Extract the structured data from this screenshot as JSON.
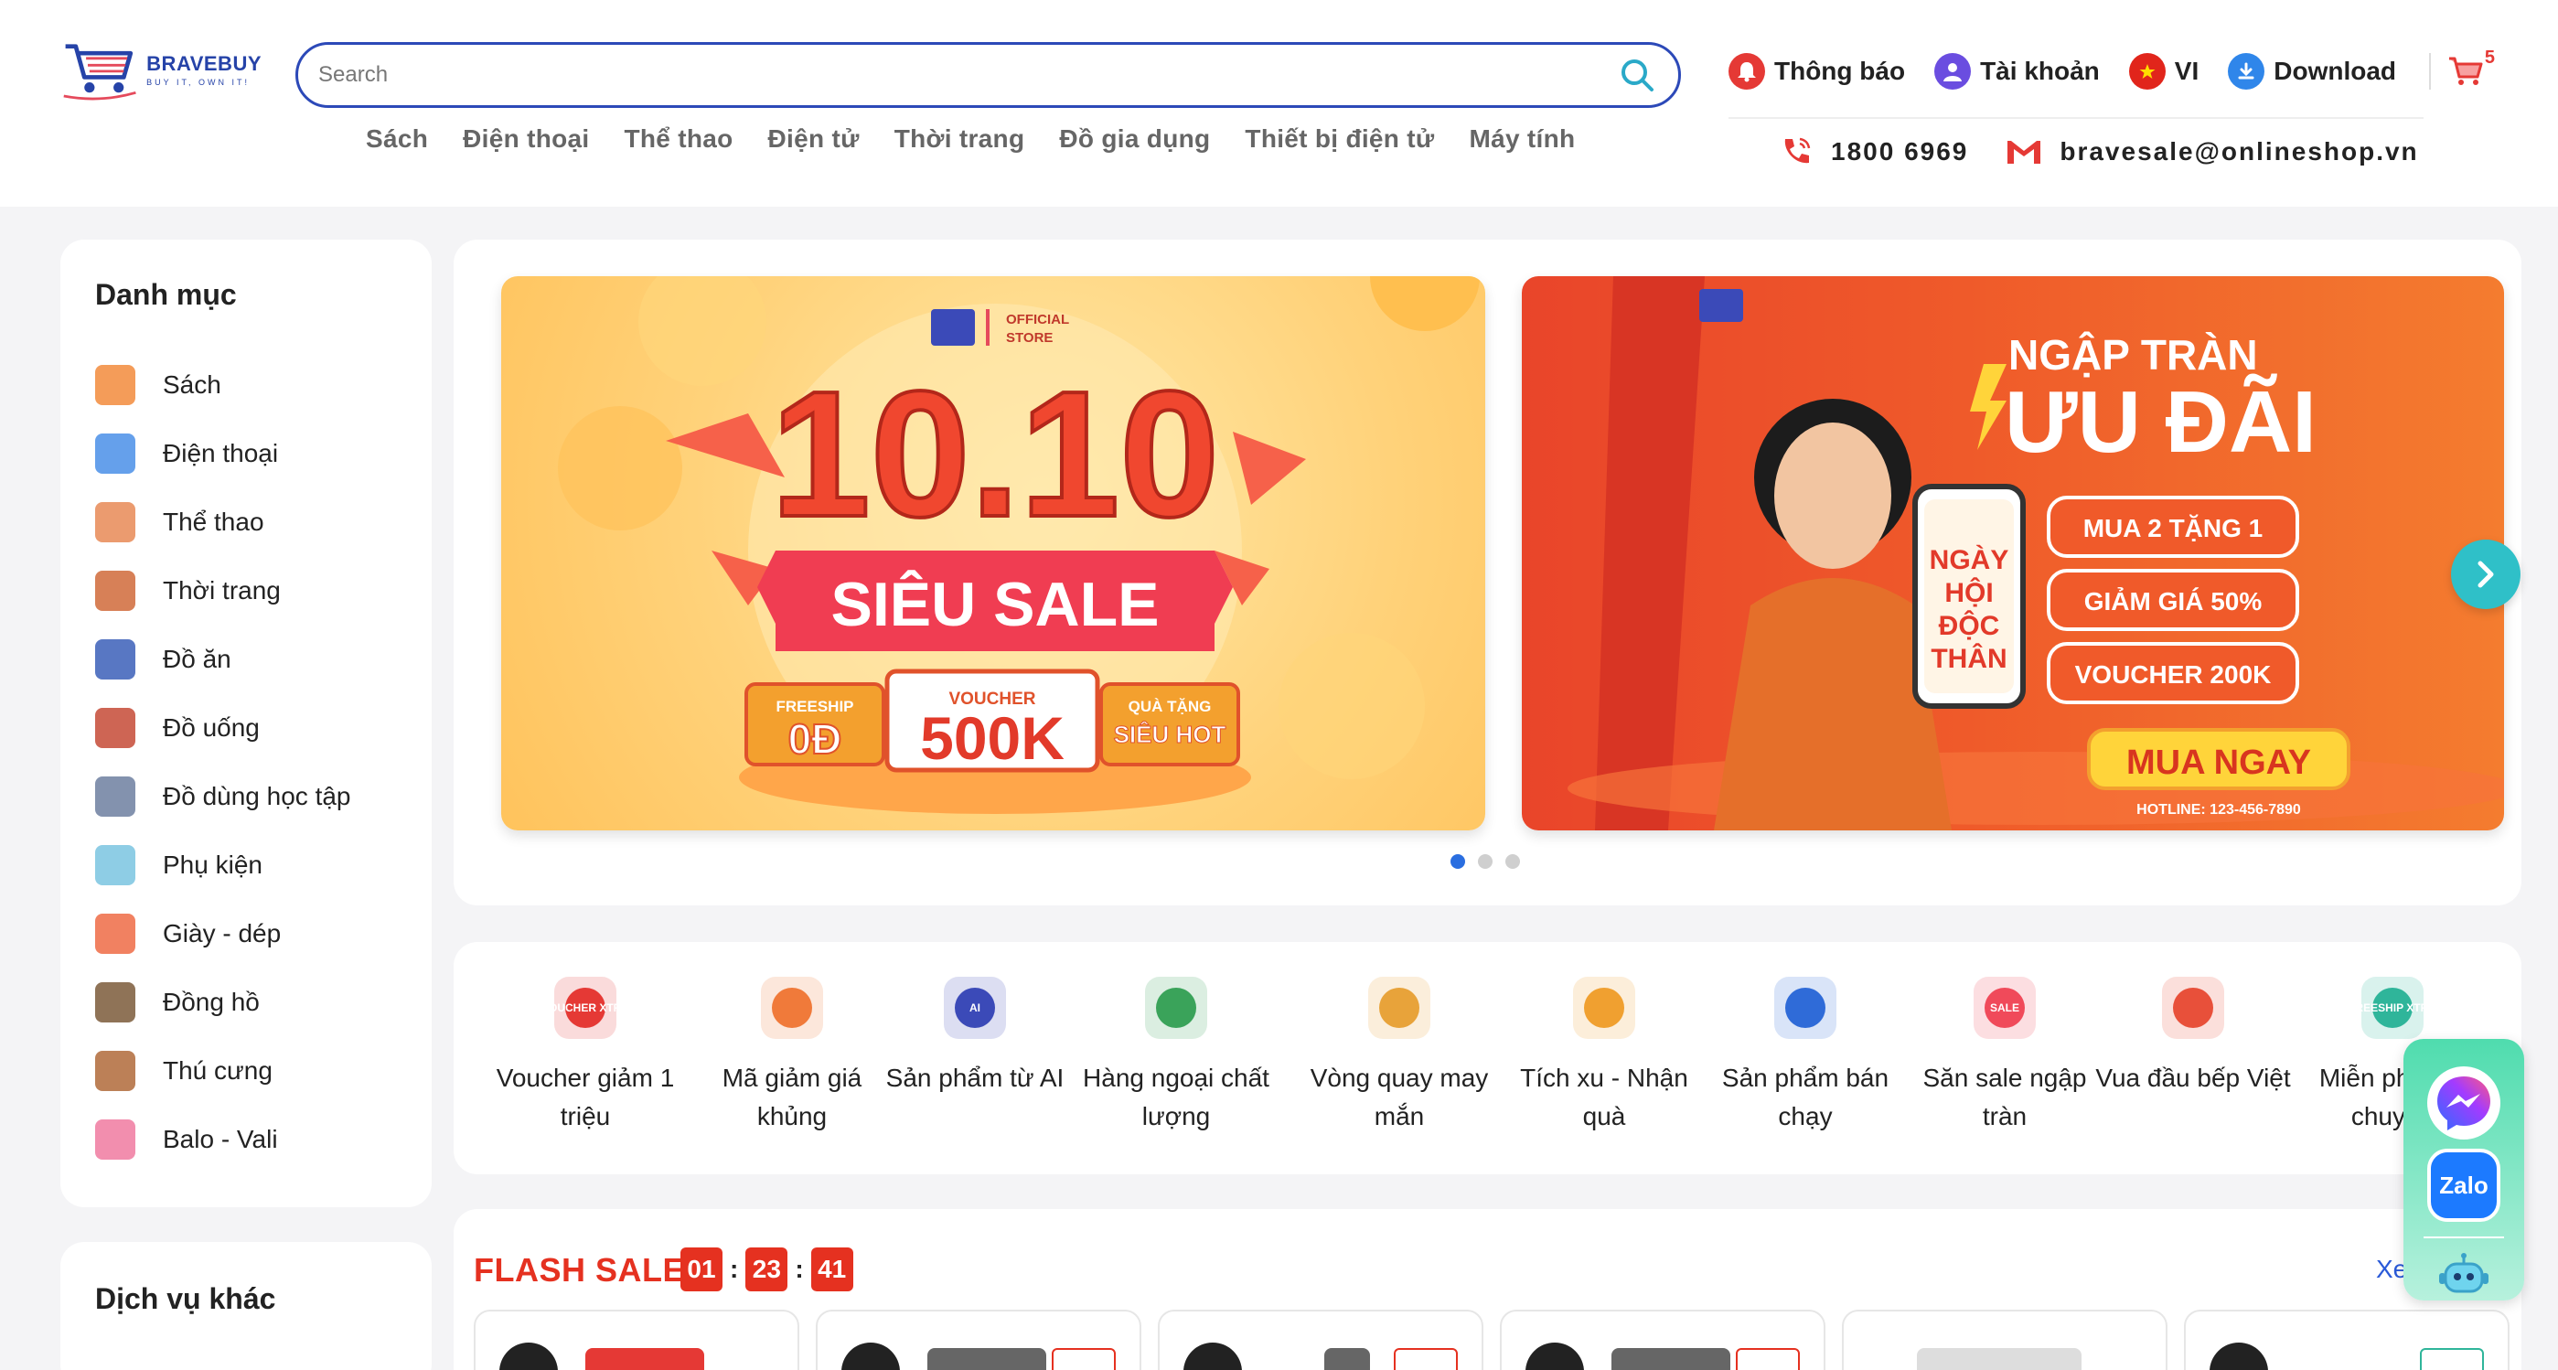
{
  "brand": {
    "name": "BRAVEBUY",
    "tagline": "BUY IT, OWN IT!"
  },
  "search": {
    "placeholder": "Search"
  },
  "top_nav": [
    "Sách",
    "Điện thoại",
    "Thể thao",
    "Điện tử",
    "Thời trang",
    "Đồ gia dụng",
    "Thiết bị điện tử",
    "Máy tính"
  ],
  "utils": {
    "notifications": "Thông báo",
    "account": "Tài khoản",
    "language": "VI",
    "download": "Download",
    "cart_count": "5"
  },
  "contact": {
    "phone": "1800 6969",
    "email": "bravesale@onlineshop.vn"
  },
  "sidebar": {
    "title": "Danh mục",
    "items": [
      {
        "label": "Sách",
        "icon": "books-icon"
      },
      {
        "label": "Điện thoại",
        "icon": "phone-icon"
      },
      {
        "label": "Thể thao",
        "icon": "sports-icon"
      },
      {
        "label": "Thời trang",
        "icon": "fashion-icon"
      },
      {
        "label": "Đồ ăn",
        "icon": "food-icon"
      },
      {
        "label": "Đồ uống",
        "icon": "drinks-icon"
      },
      {
        "label": "Đồ dùng học tập",
        "icon": "stationery-icon"
      },
      {
        "label": "Phụ kiện",
        "icon": "accessories-icon"
      },
      {
        "label": "Giày - dép",
        "icon": "shoes-icon"
      },
      {
        "label": "Đồng hồ",
        "icon": "watch-icon"
      },
      {
        "label": "Thú cưng",
        "icon": "pet-icon"
      },
      {
        "label": "Balo - Vali",
        "icon": "luggage-icon"
      }
    ]
  },
  "services": {
    "title": "Dịch vụ khác"
  },
  "banner1": {
    "official": "OFFICIAL",
    "store": "STORE",
    "headline": "10.10",
    "ribbon": "SIÊU SALE",
    "freeship_label": "FREESHIP",
    "freeship_value": "0Đ",
    "voucher_label": "VOUCHER",
    "voucher_value": "500K",
    "gift_label": "QUÀ TẶNG",
    "gift_value": "SIÊU HOT"
  },
  "banner2": {
    "line1": "NGẬP TRÀN",
    "line2": "ƯU ĐÃI",
    "phone_text": "NGÀY HỘI ĐỘC THÂN",
    "offer1": "MUA 2 TẶNG 1",
    "offer2": "GIẢM GIÁ 50%",
    "offer3": "VOUCHER 200K",
    "cta": "MUA NGAY",
    "hotline": "HOTLINE: 123-456-7890"
  },
  "quick_links": [
    {
      "label": "Voucher giảm 1 triệu",
      "icon": "voucher-xtra-icon",
      "badge": "VOUCHER XTRA"
    },
    {
      "label": "Mã giảm giá khủng",
      "icon": "coupon-icon",
      "badge": ""
    },
    {
      "label": "Sản phẩm từ AI",
      "icon": "ai-icon",
      "badge": "AI"
    },
    {
      "label": "Hàng ngoại chất lượng",
      "icon": "globe-icon",
      "badge": ""
    },
    {
      "label": "Vòng quay may mắn",
      "icon": "lucky-wheel-icon",
      "badge": ""
    },
    {
      "label": "Tích xu - Nhận quà",
      "icon": "coin-bag-icon",
      "badge": ""
    },
    {
      "label": "Sản phẩm bán chạy",
      "icon": "trending-chart-icon",
      "badge": ""
    },
    {
      "label": "Săn sale ngập tràn",
      "icon": "sale-tag-icon",
      "badge": "SALE"
    },
    {
      "label": "Vua đầu bếp Việt",
      "icon": "kitchen-icon",
      "badge": ""
    },
    {
      "label": "Miễn phí vận chuyển",
      "icon": "freeship-xtra-icon",
      "badge": "FREESHIP XTRA"
    }
  ],
  "flash_sale": {
    "title": "FLASH SALE !",
    "hours": "01",
    "minutes": "23",
    "seconds": "41",
    "see_more": "Xem tất cả"
  },
  "colors": {
    "brand_blue": "#2c49b8",
    "sale_red": "#e53120",
    "accent_teal": "#2fc0c8"
  }
}
